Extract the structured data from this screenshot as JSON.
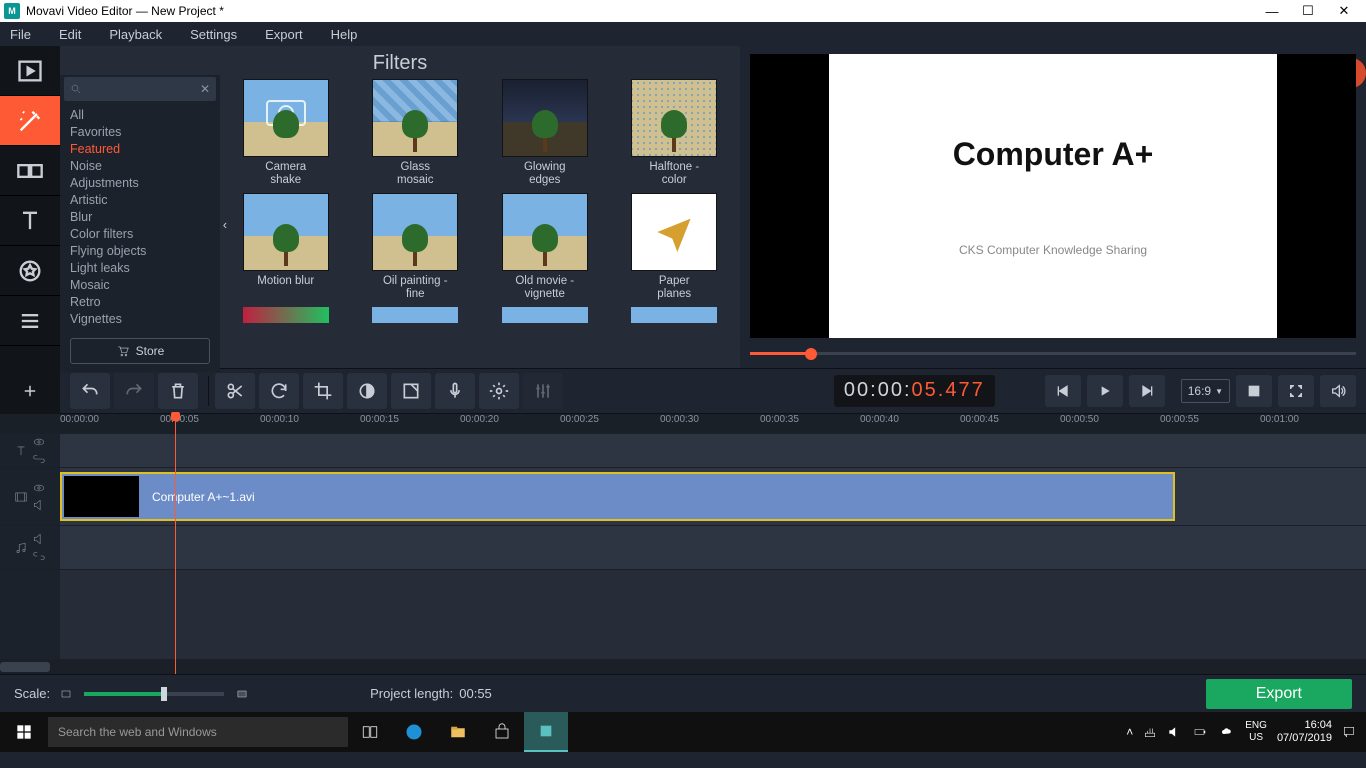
{
  "titlebar": {
    "app_title": "Movavi Video Editor — New Project *"
  },
  "menu": {
    "items": [
      "File",
      "Edit",
      "Playback",
      "Settings",
      "Export",
      "Help"
    ]
  },
  "sidebar_tools": [
    "import",
    "filters",
    "transitions",
    "titles",
    "stickers",
    "more"
  ],
  "panel": {
    "title": "Filters",
    "categories": [
      "All",
      "Favorites",
      "Featured",
      "Noise",
      "Adjustments",
      "Artistic",
      "Blur",
      "Color filters",
      "Flying objects",
      "Light leaks",
      "Mosaic",
      "Retro",
      "Vignettes"
    ],
    "selected_category": "Featured",
    "store_label": "Store",
    "filters": [
      {
        "label": "Camera\nshake"
      },
      {
        "label": "Glass\nmosaic"
      },
      {
        "label": "Glowing\nedges"
      },
      {
        "label": "Halftone -\ncolor"
      },
      {
        "label": "Motion blur"
      },
      {
        "label": "Oil painting -\nfine"
      },
      {
        "label": "Old movie -\nvignette"
      },
      {
        "label": "Paper\nplanes"
      }
    ]
  },
  "preview": {
    "slide_title": "Computer A+",
    "slide_subtitle": "CKS Computer Knowledge Sharing",
    "timecode_white": "00:00:",
    "timecode_white2": "0",
    "timecode_orange": "5.477",
    "aspect": "16:9"
  },
  "timeline": {
    "marks": [
      "00:00:00",
      "00:00:05",
      "00:00:10",
      "00:00:15",
      "00:00:20",
      "00:00:25",
      "00:00:30",
      "00:00:35",
      "00:00:40",
      "00:00:45",
      "00:00:50",
      "00:00:55",
      "00:01:00"
    ],
    "clip_name": "Computer A+~1.avi"
  },
  "bottom": {
    "scale_label": "Scale:",
    "project_length_label": "Project length:",
    "project_length": "00:55",
    "export_label": "Export"
  },
  "taskbar": {
    "search_placeholder": "Search the web and Windows",
    "lang1": "ENG",
    "lang2": "US",
    "time": "16:04",
    "date": "07/07/2019"
  }
}
